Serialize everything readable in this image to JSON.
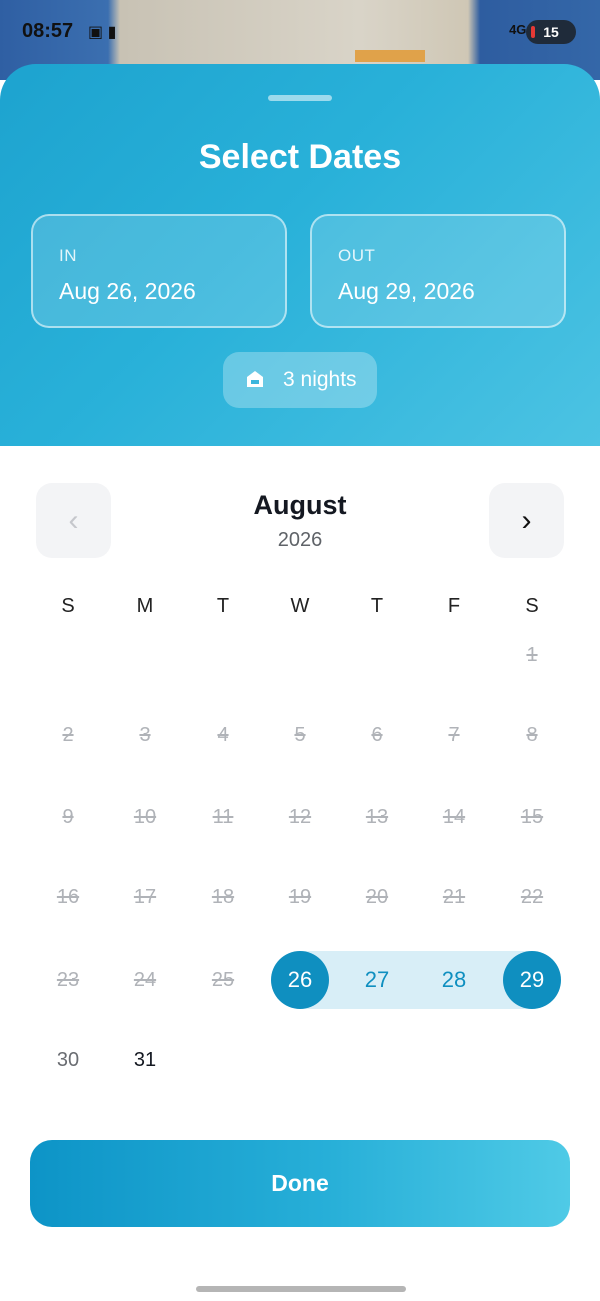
{
  "status_bar": {
    "time": "08:57",
    "network": "4G+",
    "battery": "15"
  },
  "header": {
    "title": "Select Dates",
    "check_in": {
      "label": "IN",
      "value": "Aug 26, 2026"
    },
    "check_out": {
      "label": "OUT",
      "value": "Aug 29, 2026"
    },
    "nights": {
      "label": "3 nights",
      "icon": "home-icon"
    }
  },
  "calendar": {
    "month": "August",
    "year": "2026",
    "prev_icon": "chevron-left-icon",
    "next_icon": "chevron-right-icon",
    "weekdays": [
      "S",
      "M",
      "T",
      "W",
      "T",
      "F",
      "S"
    ],
    "first_weekday_index": 6,
    "days_in_month": 31,
    "past_days_through": 25,
    "selected_start": 26,
    "selected_end": 29,
    "colors": {
      "accent": "#0f8fc0",
      "range_band": "#d8eef7",
      "disabled": "#b0b3b8"
    }
  },
  "footer": {
    "done_label": "Done"
  }
}
